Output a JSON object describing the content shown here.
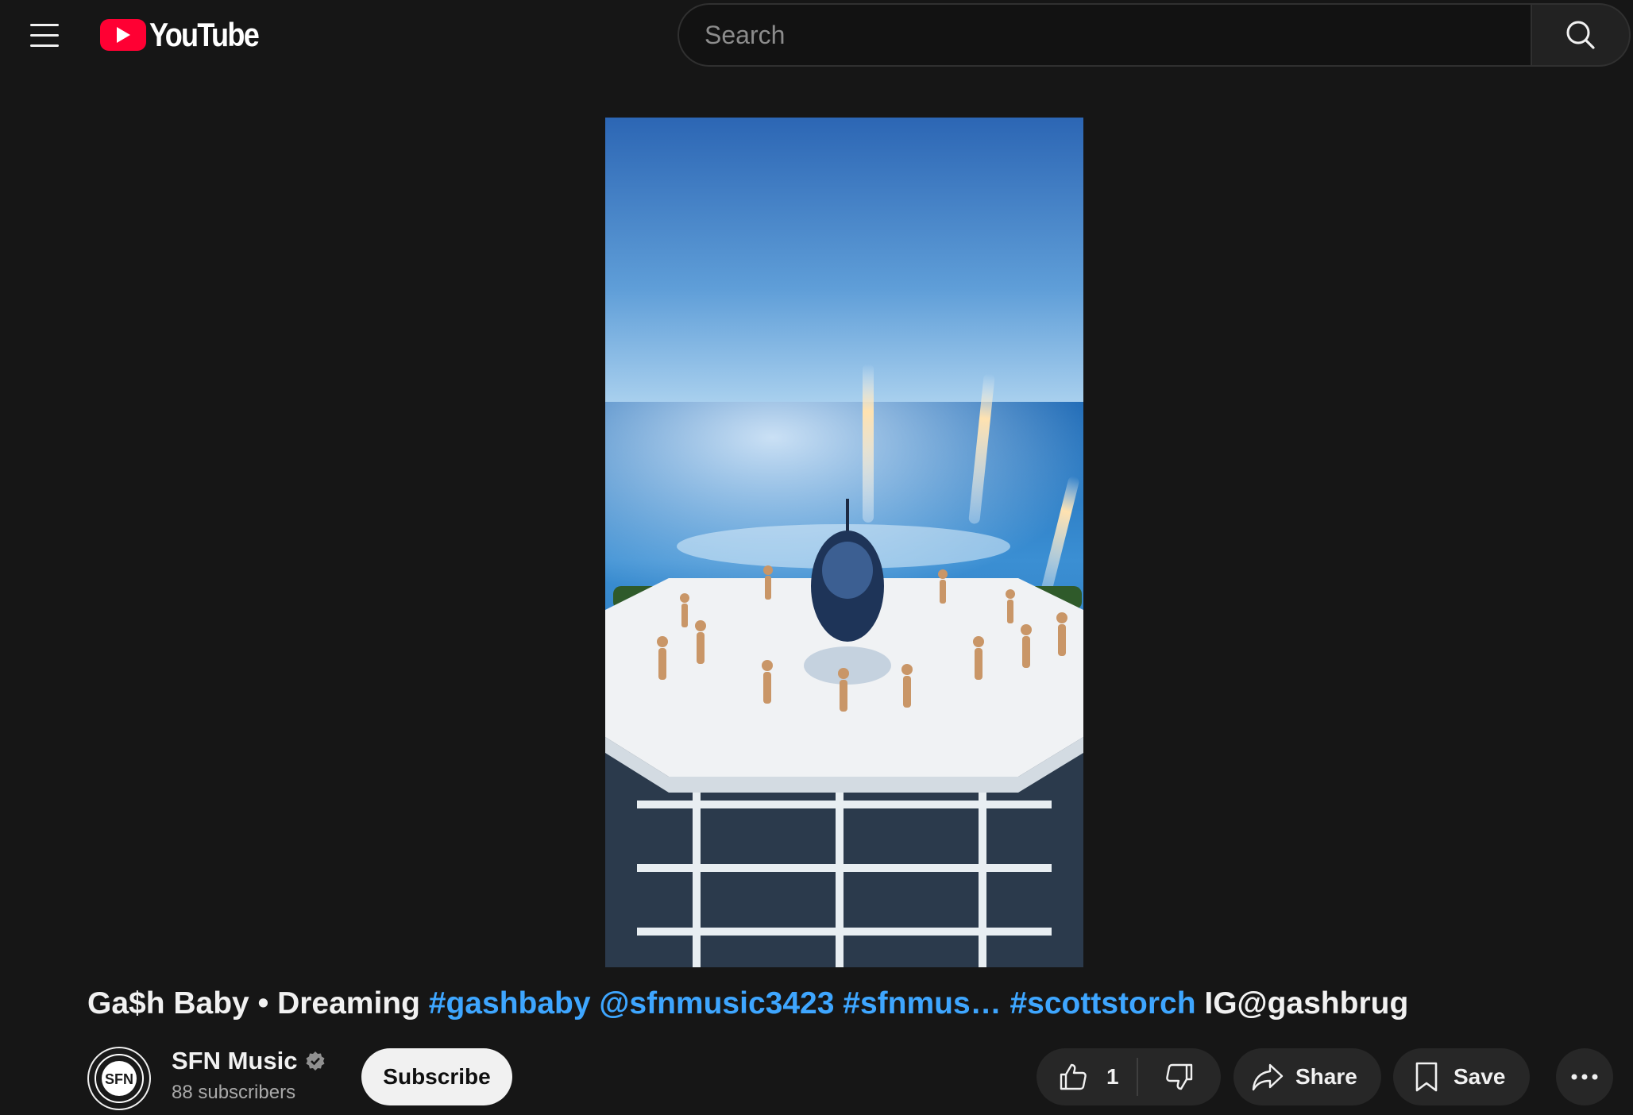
{
  "header": {
    "logo_text": "YouTube",
    "search_placeholder": "Search"
  },
  "video": {
    "title_plain": "Ga$h Baby • Dreaming",
    "hashtags": [
      "#gashbaby",
      "@sfnmusic3423",
      "#sfnmus…",
      "#scottstorch"
    ],
    "title_tail": "IG@gashbrug"
  },
  "channel": {
    "name": "SFN Music",
    "subscribers": "88 subscribers",
    "subscribe_label": "Subscribe"
  },
  "actions": {
    "like_count": "1",
    "share_label": "Share",
    "save_label": "Save"
  },
  "colors": {
    "background": "#161616",
    "link": "#3ea6ff",
    "brand_red": "#ff0033",
    "pill_bg": "#272727"
  }
}
